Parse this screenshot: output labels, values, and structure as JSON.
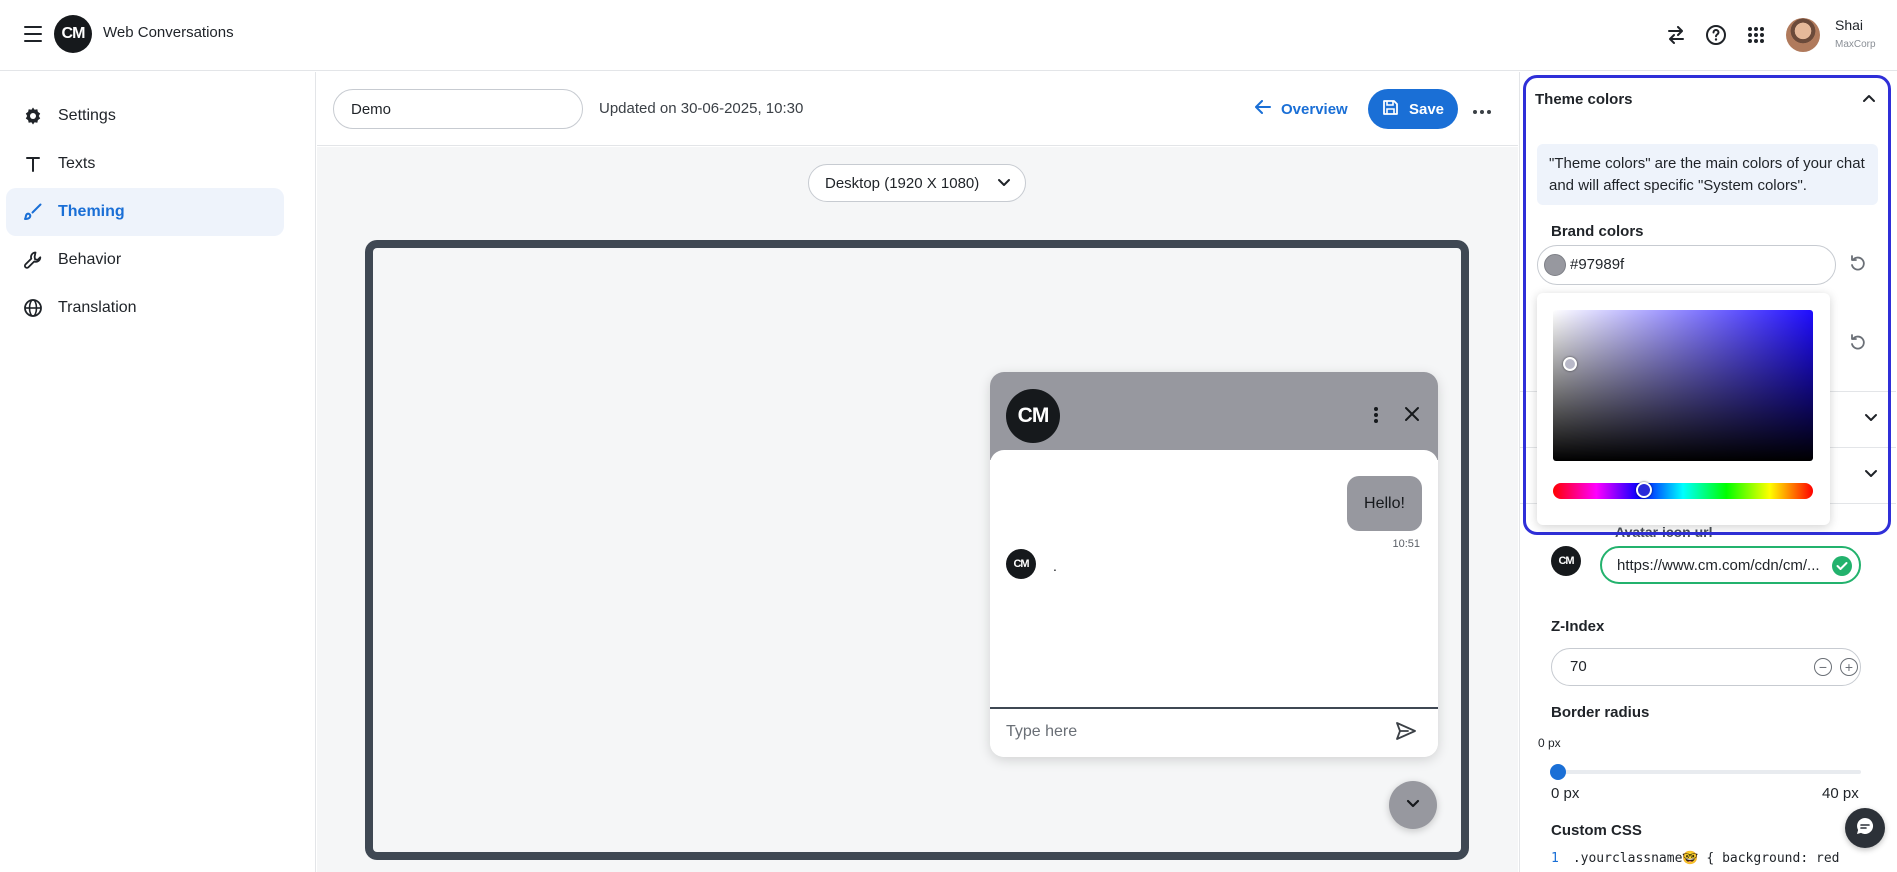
{
  "header": {
    "app_title": "Web Conversations",
    "logo_text": "CM",
    "user_name": "Shai",
    "user_org": "MaxCorp"
  },
  "sidebar": {
    "items": [
      {
        "label": "Settings",
        "icon": "gear-icon"
      },
      {
        "label": "Texts",
        "icon": "text-icon"
      },
      {
        "label": "Theming",
        "icon": "brush-icon",
        "active": true
      },
      {
        "label": "Behavior",
        "icon": "wrench-icon"
      },
      {
        "label": "Translation",
        "icon": "globe-icon"
      }
    ]
  },
  "toolbar": {
    "name_value": "Demo",
    "updated": "Updated on 30-06-2025, 10:30",
    "overview_label": "Overview",
    "save_label": "Save"
  },
  "preview": {
    "device_label": "Desktop (1920 X 1080)",
    "chat": {
      "logo_text": "CM",
      "message": "Hello!",
      "message_time": "10:51",
      "typing": ".",
      "input_placeholder": "Type here"
    }
  },
  "panel": {
    "theme_title": "Theme colors",
    "info_text": "\"Theme colors\" are the main colors of your chat and will affect specific \"System colors\".",
    "brand_label": "Brand colors",
    "brand_value": "#97989f",
    "avatar_label": "Avatar icon url",
    "avatar_url": "https://www.cm.com/cdn/cm/...",
    "zindex_label": "Z-Index",
    "zindex_value": "70",
    "border_radius_label": "Border radius",
    "border_radius_current": "0 px",
    "border_radius_min": "0 px",
    "border_radius_max": "40 px",
    "border_radius_value": 0,
    "custom_css_label": "Custom CSS",
    "css_line_no": "1",
    "css_line": ".yourclassname🤓 { background: red"
  },
  "colors": {
    "accent": "#1a6fd6",
    "brand": "#97989f",
    "highlight_border": "#2f2fd8",
    "success": "#23b26d"
  }
}
